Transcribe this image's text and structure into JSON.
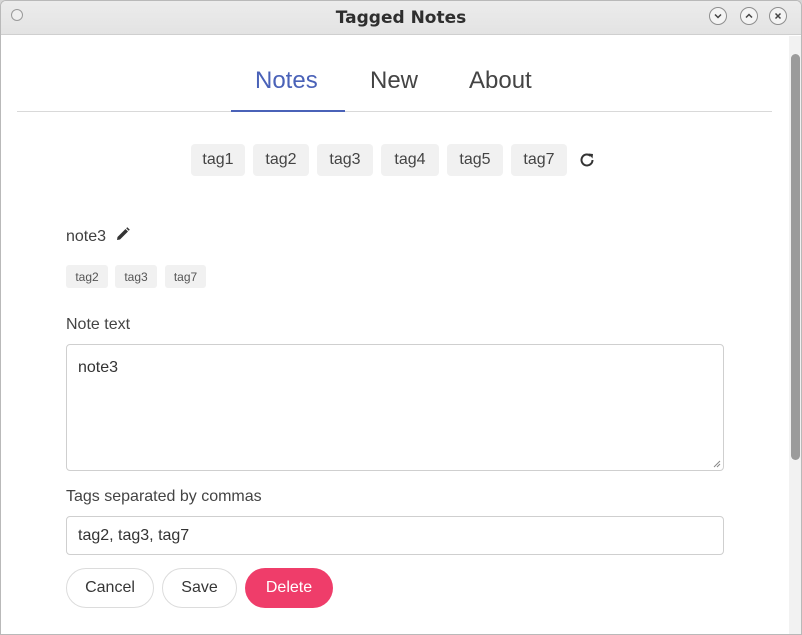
{
  "window": {
    "title": "Tagged Notes"
  },
  "tabs": [
    {
      "label": "Notes",
      "active": true
    },
    {
      "label": "New",
      "active": false
    },
    {
      "label": "About",
      "active": false
    }
  ],
  "tag_filter": [
    "tag1",
    "tag2",
    "tag3",
    "tag4",
    "tag5",
    "tag7"
  ],
  "note": {
    "title": "note3",
    "tags": [
      "tag2",
      "tag3",
      "tag7"
    ],
    "text_label": "Note text",
    "text_value": "note3",
    "tags_label": "Tags separated by commas",
    "tags_value": "tag2, tag3, tag7"
  },
  "actions": {
    "cancel": "Cancel",
    "save": "Save",
    "delete": "Delete"
  },
  "colors": {
    "accent": "#4a62b8",
    "danger": "#ef3d6a"
  },
  "icons": {
    "refresh": "refresh-icon",
    "edit": "pencil-icon"
  }
}
